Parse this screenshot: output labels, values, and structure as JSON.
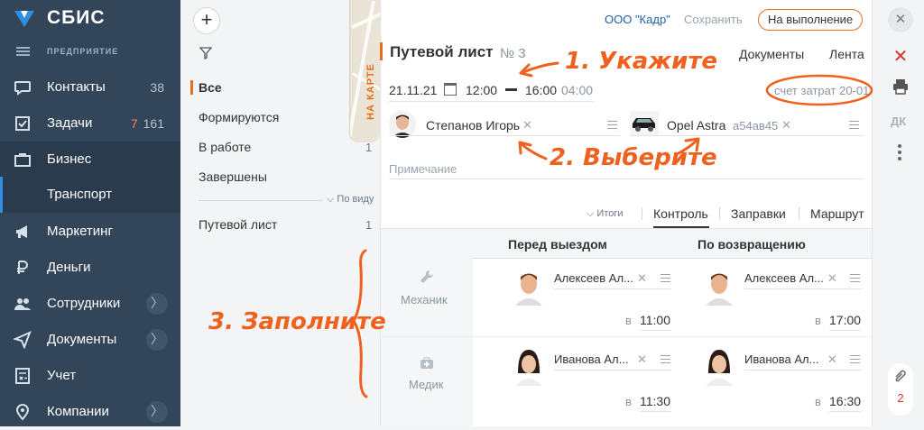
{
  "sidebar": {
    "logo": "СБИС",
    "org_label": "ПРЕДПРИЯТИЕ",
    "items": [
      {
        "label": "Контакты",
        "count": "38",
        "icon": "chat-icon"
      },
      {
        "label": "Задачи",
        "count_red": "7",
        "count": "161",
        "icon": "tasks-icon"
      },
      {
        "label": "Бизнес",
        "icon": "briefcase-icon"
      },
      {
        "label": "Транспорт"
      },
      {
        "label": "Маркетинг",
        "icon": "megaphone-icon"
      },
      {
        "label": "Деньги",
        "icon": "ruble-icon"
      },
      {
        "label": "Сотрудники",
        "icon": "people-icon",
        "chevron": "〉"
      },
      {
        "label": "Документы",
        "icon": "send-icon",
        "chevron": "〉"
      },
      {
        "label": "Учет",
        "icon": "calculator-icon"
      },
      {
        "label": "Компании",
        "icon": "location-icon",
        "chevron": "〉"
      }
    ]
  },
  "filters": {
    "items": [
      {
        "label": "Все",
        "count": ""
      },
      {
        "label": "Формируются",
        "count": ""
      },
      {
        "label": "В работе",
        "count": "1"
      },
      {
        "label": "Завершены",
        "count": ""
      }
    ],
    "by_view": "По виду",
    "doc_types": [
      {
        "label": "Путевой лист",
        "count": "1"
      }
    ],
    "map_tab": "НА КАРТЕ"
  },
  "header": {
    "org": "ООО \"Кадр\"",
    "save": "Сохранить",
    "status_button": "На выполнение"
  },
  "doc": {
    "title": "Путевой лист",
    "number": "№ 3",
    "tabs_top": [
      "Документы",
      "Лента"
    ],
    "date": "21.11.21",
    "time_start": "12:00",
    "time_end": "16:00",
    "duration": "04:00",
    "cost_account": "счет затрат 20-01",
    "driver": "Степанов Игорь",
    "car": "Opel Astra",
    "car_plate": "а54ав45",
    "note_placeholder": "Примечание",
    "itogi": "Итоги",
    "tabs": [
      "Контроль",
      "Заправки",
      "Маршрут"
    ],
    "table": {
      "col_before": "Перед выездом",
      "col_after": "По возвращению",
      "rows": [
        {
          "role": "Механик",
          "before_name": "Алексеев Ал...",
          "before_time_prefix": "в",
          "before_time": "11:00",
          "after_name": "Алексеев Ал...",
          "after_time_prefix": "в",
          "after_time": "17:00"
        },
        {
          "role": "Медик",
          "before_name": "Иванова Ал...",
          "before_time_prefix": "в",
          "before_time": "11:30",
          "after_name": "Иванова Ал...",
          "after_time_prefix": "в",
          "after_time": "16:30"
        }
      ]
    }
  },
  "toolbar": {
    "dk": "ДК",
    "bottom_count": "2"
  },
  "annotations": {
    "a1": "1. Укажите",
    "a2": "2. Выберите",
    "a3": "3. Заполните"
  },
  "colors": {
    "accent": "#e86e1d",
    "sidebar": "#324559",
    "annotation": "#f0601f",
    "link": "#1f5fa8"
  }
}
